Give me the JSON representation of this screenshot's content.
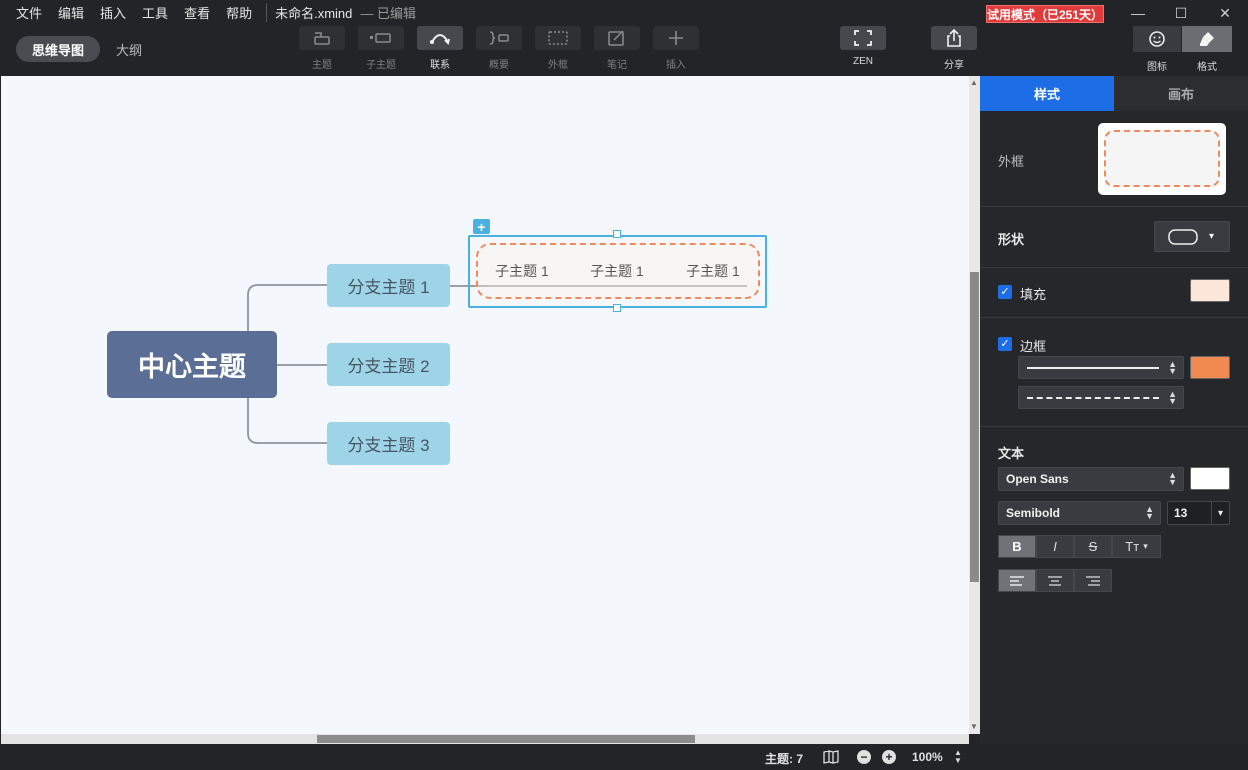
{
  "menu": [
    "文件",
    "编辑",
    "插入",
    "工具",
    "查看",
    "帮助"
  ],
  "document": {
    "filename": "未命名.xmind",
    "status": "— 已编辑"
  },
  "trial_badge": "试用模式（已251天）",
  "view_modes": {
    "active": "思维导图",
    "inactive": "大纲"
  },
  "tools": [
    {
      "label": "主题",
      "icon": "topic-icon"
    },
    {
      "label": "子主题",
      "icon": "subtopic-icon"
    },
    {
      "label": "联系",
      "icon": "relationship-icon"
    },
    {
      "label": "概要",
      "icon": "summary-icon"
    },
    {
      "label": "外框",
      "icon": "boundary-icon"
    },
    {
      "label": "笔记",
      "icon": "note-icon"
    },
    {
      "label": "插入",
      "icon": "plus-icon"
    },
    {
      "label": "ZEN",
      "icon": "fullscreen-icon"
    },
    {
      "label": "分享",
      "icon": "share-icon"
    }
  ],
  "right_tools": [
    {
      "label": "图标",
      "icon": "smiley-icon"
    },
    {
      "label": "格式",
      "icon": "brush-icon"
    }
  ],
  "mindmap": {
    "central": "中心主题",
    "branches": [
      "分支主题 1",
      "分支主题 2",
      "分支主题 3"
    ],
    "subtopics": [
      "子主题 1",
      "子主题 1",
      "子主题 1"
    ]
  },
  "panel": {
    "tabs": {
      "active": "样式",
      "inactive": "画布"
    },
    "boundary_label": "外框",
    "shape_label": "形状",
    "fill": {
      "label": "填充",
      "checked": true,
      "color": "#fde6da"
    },
    "border": {
      "label": "边框",
      "checked": true,
      "color": "#f08a50"
    },
    "text": {
      "label": "文本",
      "font": "Open Sans",
      "weight": "Semibold",
      "size": "13",
      "color": "#ffffff",
      "styles": [
        "B",
        "I",
        "S",
        "Tт"
      ]
    }
  },
  "status": {
    "topics_label": "主题: 7",
    "zoom": "100%"
  },
  "colors": {
    "accent": "#1d6ee6",
    "central": "#5b6f96",
    "branch": "#9dd4e8",
    "boundary_dash": "#ef8a5e"
  }
}
